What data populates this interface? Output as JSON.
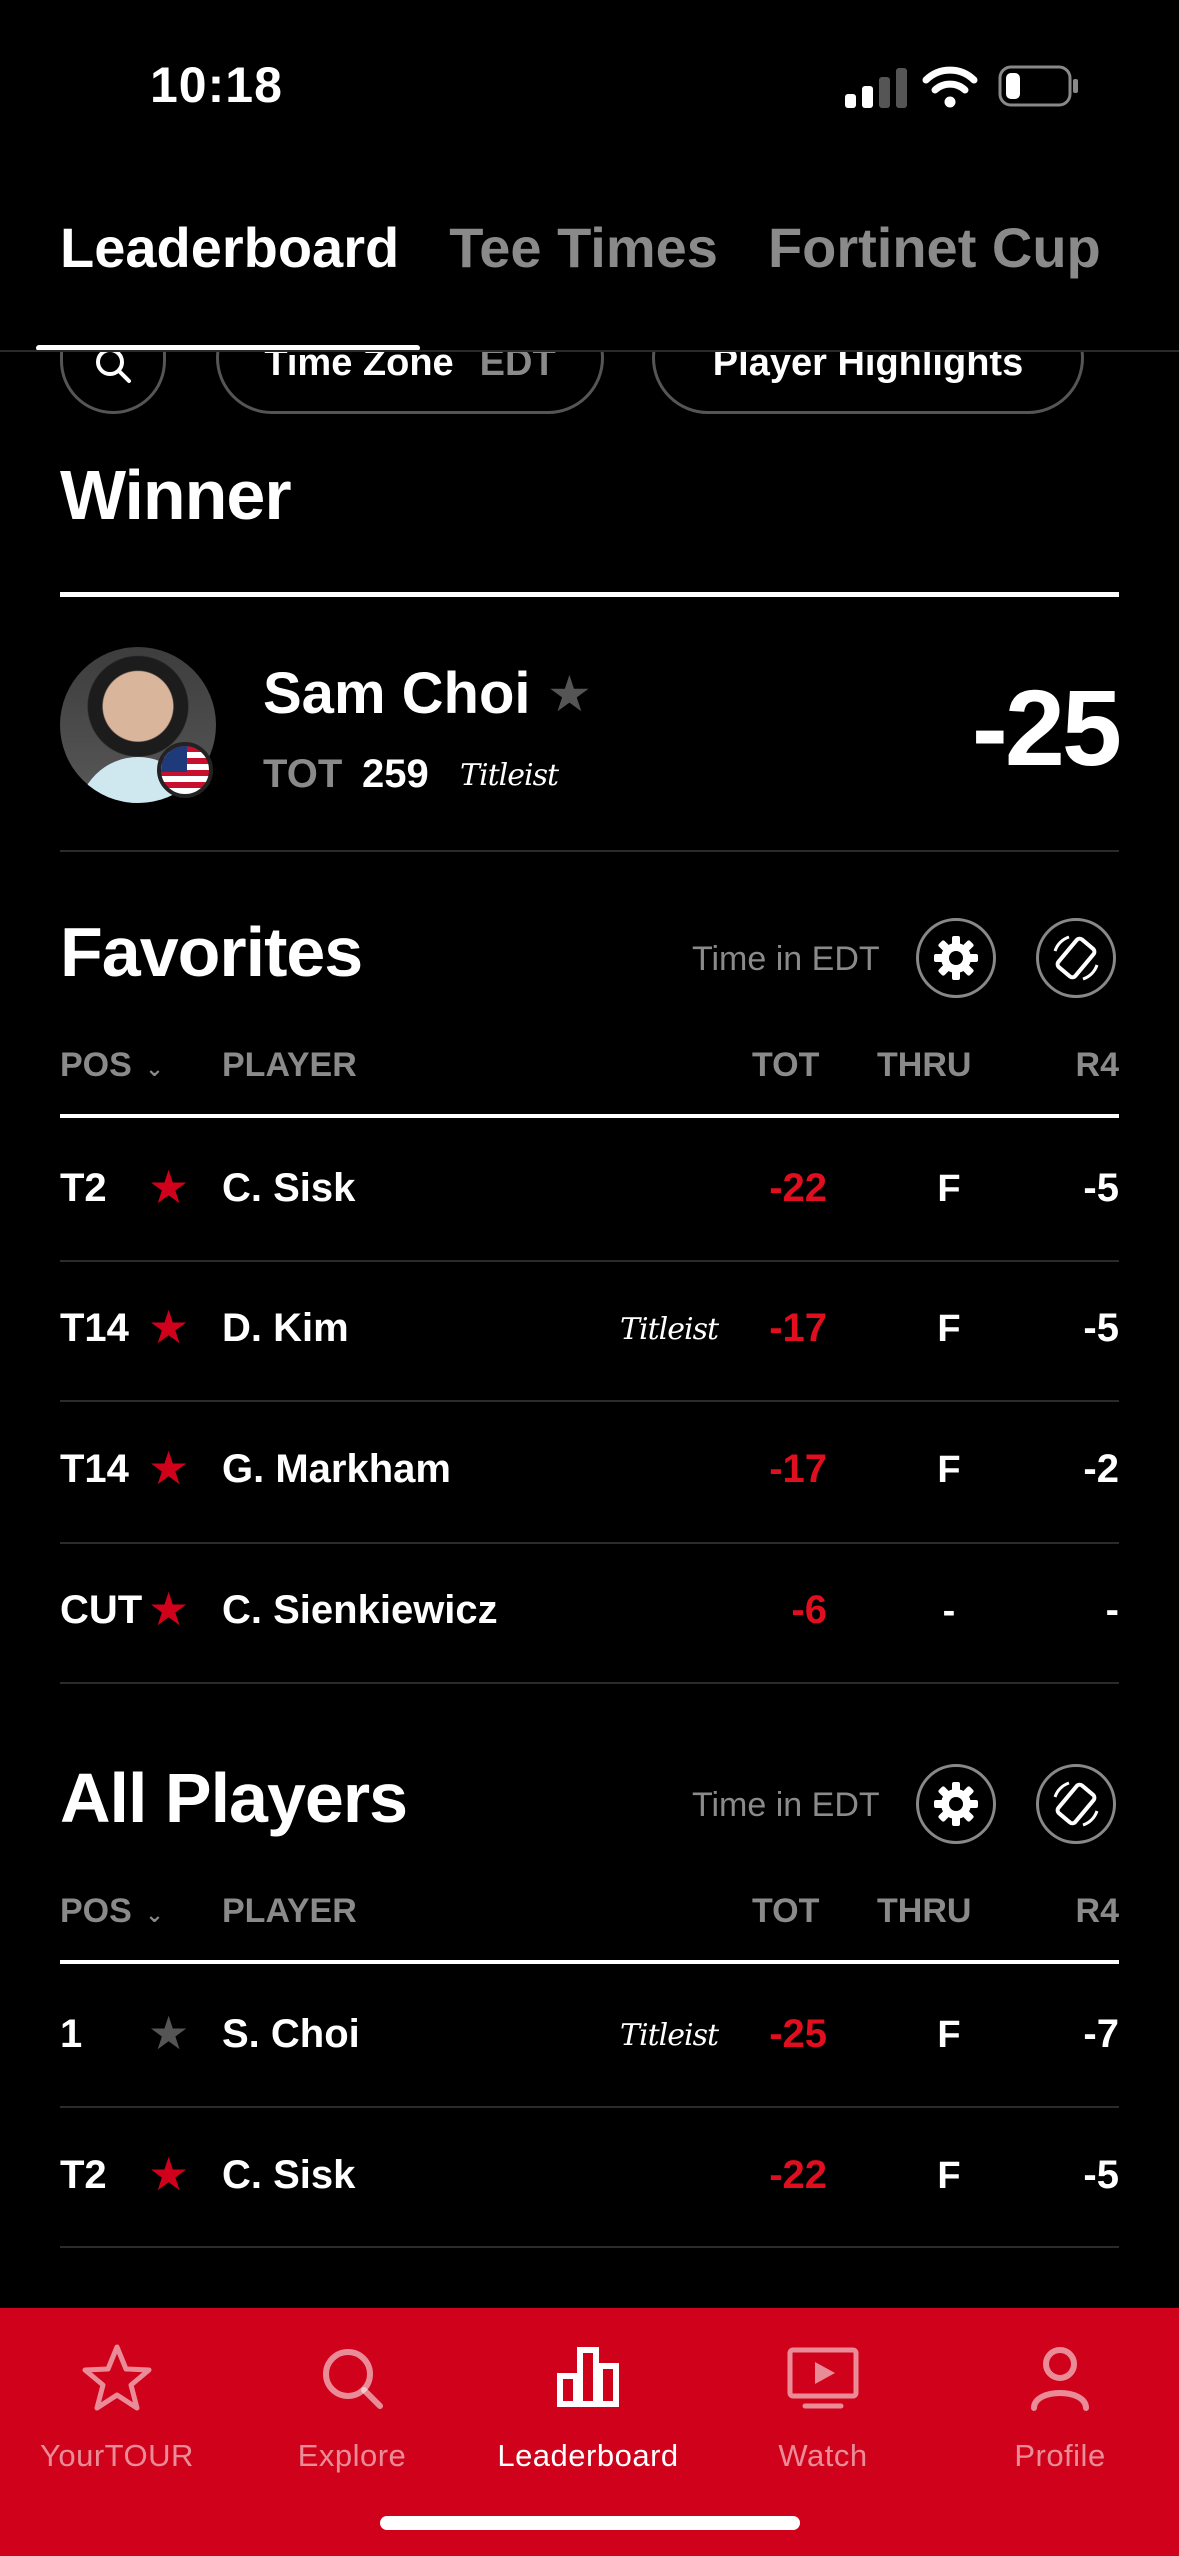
{
  "status": {
    "time": "10:18"
  },
  "tabs": [
    {
      "label": "Leaderboard",
      "active": true
    },
    {
      "label": "Tee Times",
      "active": false
    },
    {
      "label": "Fortinet Cup",
      "active": false
    }
  ],
  "chips": {
    "time_zone_label": "Time Zone",
    "time_zone_value": "EDT",
    "highlights": "Player Highlights"
  },
  "winner": {
    "heading": "Winner",
    "name": "Sam Choi",
    "tot_label": "TOT",
    "tot": "259",
    "brand": "Titleist",
    "score": "-25"
  },
  "favorites": {
    "title": "Favorites",
    "time_note": "Time in EDT",
    "columns": {
      "pos": "POS",
      "player": "PLAYER",
      "tot": "TOT",
      "thru": "THRU",
      "r4": "R4"
    },
    "rows": [
      {
        "pos": "T2",
        "player": "C. Sisk",
        "brand": "",
        "tot": "-22",
        "thru": "F",
        "r4": "-5",
        "fav": true
      },
      {
        "pos": "T14",
        "player": "D. Kim",
        "brand": "Titleist",
        "tot": "-17",
        "thru": "F",
        "r4": "-5",
        "fav": true
      },
      {
        "pos": "T14",
        "player": "G. Markham",
        "brand": "",
        "tot": "-17",
        "thru": "F",
        "r4": "-2",
        "fav": true
      },
      {
        "pos": "CUT",
        "player": "C. Sienkiewicz",
        "brand": "",
        "tot": "-6",
        "thru": "-",
        "r4": "-",
        "fav": true
      }
    ]
  },
  "all_players": {
    "title": "All Players",
    "time_note": "Time in EDT",
    "columns": {
      "pos": "POS",
      "player": "PLAYER",
      "tot": "TOT",
      "thru": "THRU",
      "r4": "R4"
    },
    "rows": [
      {
        "pos": "1",
        "player": "S. Choi",
        "brand": "Titleist",
        "tot": "-25",
        "thru": "F",
        "r4": "-7",
        "fav": false
      },
      {
        "pos": "T2",
        "player": "C. Sisk",
        "brand": "",
        "tot": "-22",
        "thru": "F",
        "r4": "-5",
        "fav": true
      }
    ]
  },
  "nav": [
    {
      "label": "YourTOUR",
      "icon": "star-icon",
      "active": false
    },
    {
      "label": "Explore",
      "icon": "search-icon",
      "active": false
    },
    {
      "label": "Leaderboard",
      "icon": "bar-chart-icon",
      "active": true
    },
    {
      "label": "Watch",
      "icon": "video-icon",
      "active": false
    },
    {
      "label": "Profile",
      "icon": "person-icon",
      "active": false
    }
  ],
  "colors": {
    "accent": "#d0021b",
    "score_red": "#e00e1e",
    "muted": "#8a8a8a"
  }
}
